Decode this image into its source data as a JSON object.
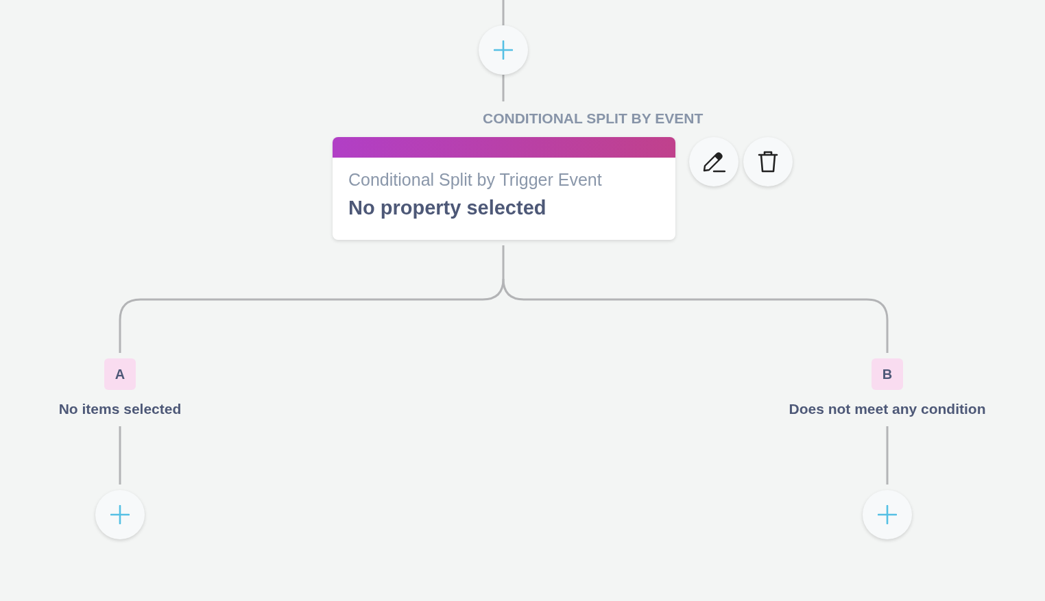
{
  "step": {
    "label": "CONDITIONAL SPLIT BY EVENT",
    "card": {
      "title": "Conditional Split by Trigger Event",
      "subtitle": "No property selected"
    }
  },
  "branches": [
    {
      "badge": "A",
      "label": "No items selected"
    },
    {
      "badge": "B",
      "label": "Does not meet any condition"
    }
  ]
}
